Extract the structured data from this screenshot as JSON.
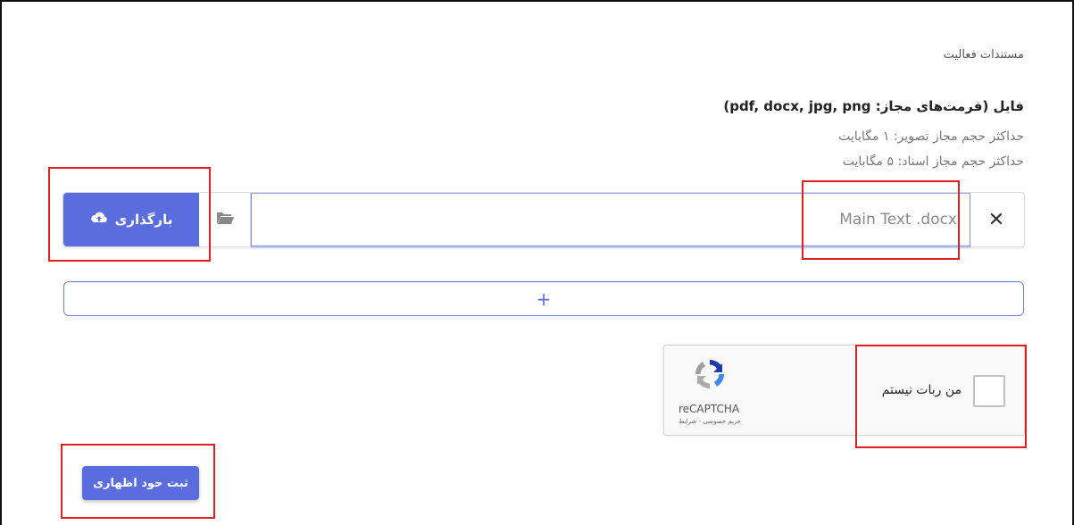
{
  "section": {
    "title": "مستندات فعالیت"
  },
  "file": {
    "label": "فایل (فرمت‌های مجاز: pdf, docx, jpg, png)",
    "hint_image": "حداکثر حجم مجاز تصویر: ۱ مگابایت",
    "hint_document": "حداکثر حجم مجاز اسناد: ۵ مگابایت",
    "upload_label": "بارگذاری",
    "file_name": "Main Text .docx",
    "clear_symbol": "✕"
  },
  "add_button": {
    "symbol": "+"
  },
  "captcha": {
    "label": "من ربات نیستم",
    "brand": "reCAPTCHA",
    "terms": "حریم خصوصی - شرایط"
  },
  "submit": {
    "label": "ثبت خود اظهاری"
  },
  "colors": {
    "accent": "#5b6dde",
    "highlight": "#e02020"
  },
  "icons": {
    "upload": "cloud-upload-icon",
    "folder": "folder-open-icon",
    "clear": "close-icon",
    "captcha": "recaptcha-logo-icon"
  }
}
